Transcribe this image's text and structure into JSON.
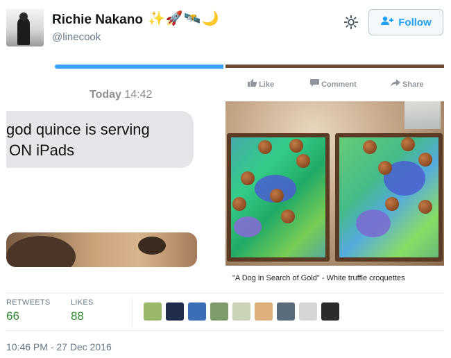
{
  "tweet": {
    "author_name": "Richie Nakano",
    "author_emojis": "✨🚀🛰️🌙",
    "author_handle": "@linecook",
    "follow_label": "Follow",
    "timestamp": "10:46 PM - 27 Dec 2016"
  },
  "media_left": {
    "timestamp_day": "Today",
    "timestamp_time": "14:42",
    "message_line1": "god quince is serving",
    "message_line2": "ON iPads"
  },
  "media_right": {
    "actions": [
      "Like",
      "Comment",
      "Share"
    ],
    "caption": "\"A Dog in Search of Gold\" - White truffle croquettes"
  },
  "stats": {
    "retweets_label": "RETWEETS",
    "retweets_value": "66",
    "likes_label": "LIKES",
    "likes_value": "88"
  },
  "likers": [
    {
      "color": "#9ab86a"
    },
    {
      "color": "#1f2d4a"
    },
    {
      "color": "#3a6fb8"
    },
    {
      "color": "#7f9b6c"
    },
    {
      "color": "#c9d4b8"
    },
    {
      "color": "#e0b07a"
    },
    {
      "color": "#5a6b7c"
    },
    {
      "color": "#d6d6d6"
    },
    {
      "color": "#2b2b2b"
    }
  ],
  "colors": {
    "accent": "#1da1f2",
    "stat_value": "#2e8b2e",
    "muted": "#657786"
  }
}
